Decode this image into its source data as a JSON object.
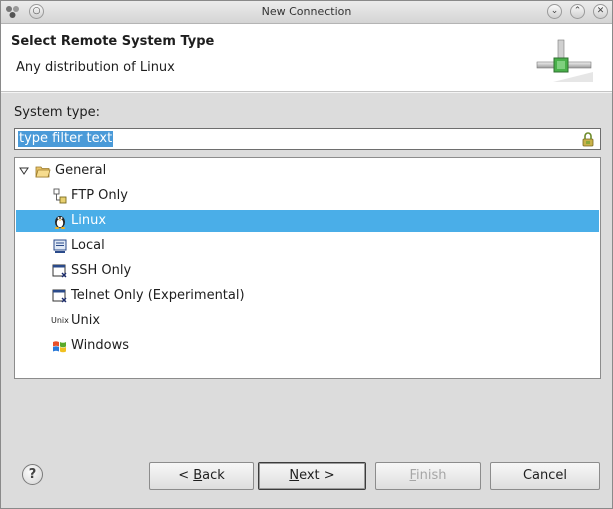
{
  "window": {
    "title": "New Connection"
  },
  "header": {
    "title": "Select Remote System Type",
    "description": "Any distribution of Linux"
  },
  "main": {
    "system_type_label": "System type:",
    "filter": {
      "value": "type filter text"
    },
    "tree": {
      "group": {
        "label": "General",
        "expanded": true
      },
      "items": [
        {
          "label": "FTP Only",
          "icon": "ftp-icon",
          "selected": false
        },
        {
          "label": "Linux",
          "icon": "linux-penguin-icon",
          "selected": true
        },
        {
          "label": "Local",
          "icon": "local-computer-icon",
          "selected": false
        },
        {
          "label": "SSH Only",
          "icon": "ssh-icon",
          "selected": false
        },
        {
          "label": "Telnet Only (Experimental)",
          "icon": "telnet-icon",
          "selected": false
        },
        {
          "label": "Unix",
          "icon": "unix-icon",
          "selected": false,
          "icon_text": "Unix"
        },
        {
          "label": "Windows",
          "icon": "windows-icon",
          "selected": false
        }
      ]
    }
  },
  "buttons": {
    "back": {
      "prefix": "< ",
      "mnemonic": "B",
      "rest": "ack"
    },
    "next": {
      "mnemonic": "N",
      "rest": "ext >"
    },
    "finish": {
      "mnemonic": "F",
      "rest": "inish"
    },
    "cancel": {
      "label": "Cancel"
    }
  },
  "colors": {
    "selection": "#4aaee8",
    "filter_highlight": "#4a9ad8"
  }
}
